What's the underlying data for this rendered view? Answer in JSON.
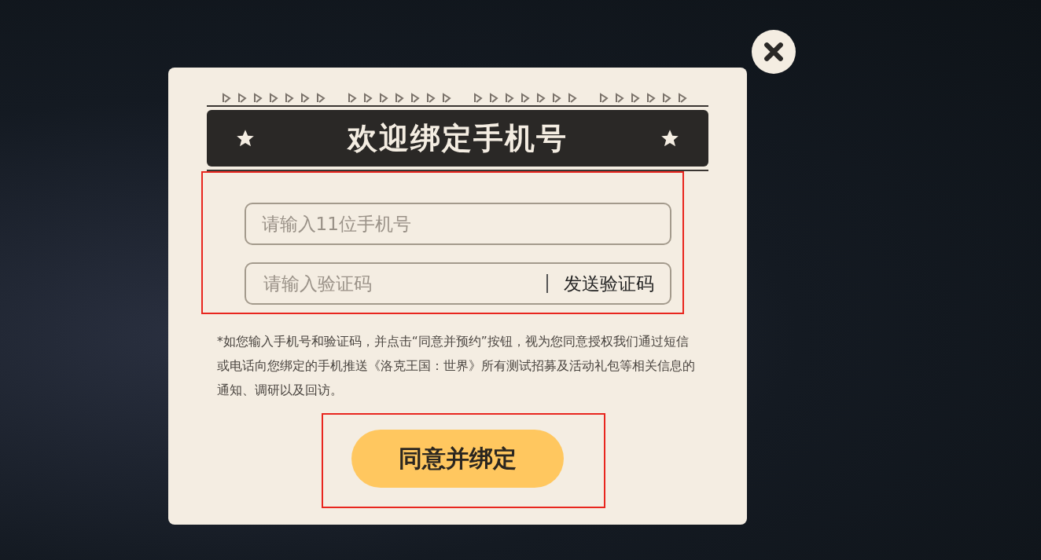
{
  "dialog": {
    "title": "欢迎绑定手机号",
    "phone_field": {
      "placeholder": "请输入11位手机号"
    },
    "code_field": {
      "placeholder": "请输入验证码"
    },
    "send_code_button": {
      "label": "发送验证码"
    },
    "notice": "*如您输入手机号和验证码，并点击“同意并预约”按钮，视为您同意授权我们通过短信或电话向您绑定的手机推送《洛克王国：世界》所有测试招募及活动礼包等相关信息的通知、调研以及回访。",
    "submit_button": {
      "label": "同意并绑定"
    }
  }
}
